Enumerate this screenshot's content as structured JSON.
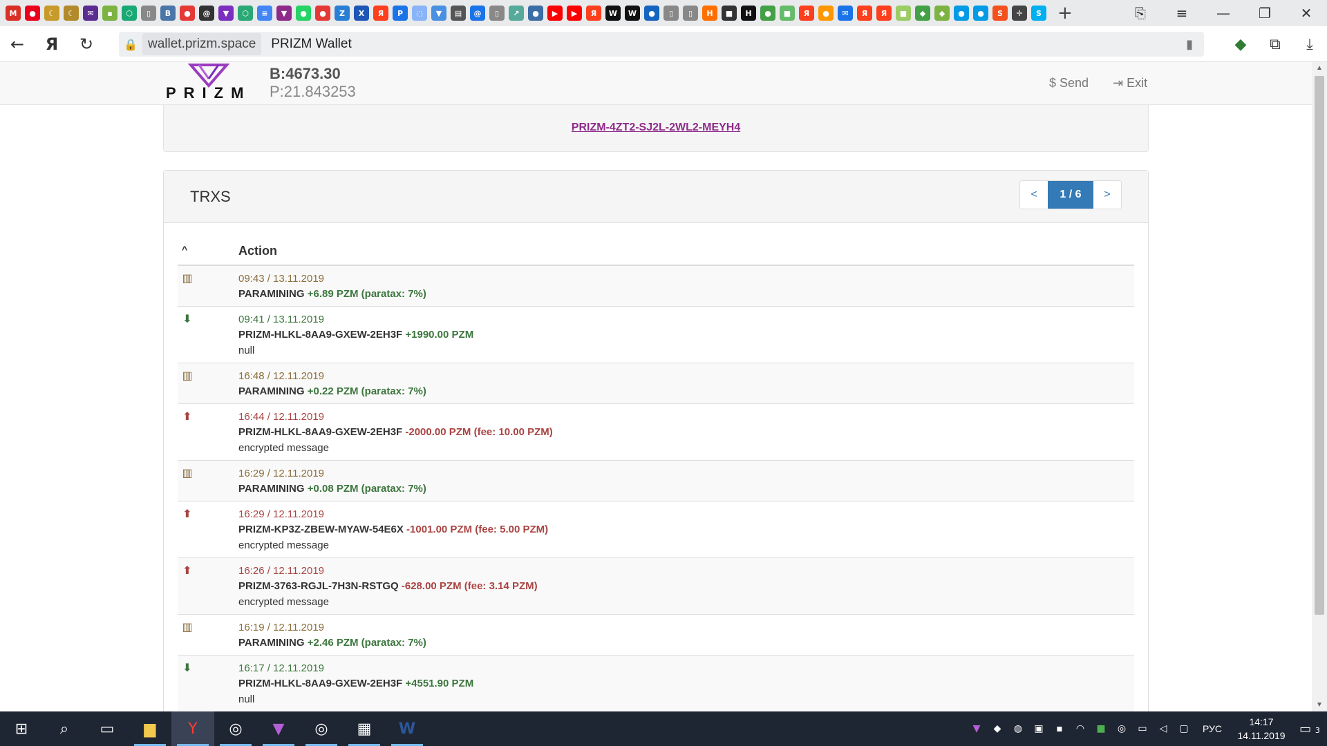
{
  "browser": {
    "favicons": [
      {
        "name": "gmail-icon",
        "glyph": "M",
        "color": "#d93025"
      },
      {
        "name": "mastercard-icon",
        "glyph": "●",
        "color": "#eb001b"
      },
      {
        "name": "moon-icon",
        "glyph": "☾",
        "color": "#c79a2a"
      },
      {
        "name": "moon-alt-icon",
        "glyph": "☾",
        "color": "#b38a2a"
      },
      {
        "name": "mail-icon",
        "glyph": "✉",
        "color": "#5b2d90"
      },
      {
        "name": "green-tab-icon",
        "glyph": "▪",
        "color": "#7cb342"
      },
      {
        "name": "hex-icon",
        "glyph": "⬡",
        "color": "#19a974"
      },
      {
        "name": "doc-icon",
        "glyph": "▯",
        "color": "#888888"
      },
      {
        "name": "vk-icon",
        "glyph": "B",
        "color": "#4a76a8"
      },
      {
        "name": "red-tab-icon",
        "glyph": "●",
        "color": "#e53935"
      },
      {
        "name": "at-icon",
        "glyph": "@",
        "color": "#333333"
      },
      {
        "name": "prism-tab-icon",
        "glyph": "▼",
        "color": "#7b2fbe"
      },
      {
        "name": "hex-green-icon",
        "glyph": "⬡",
        "color": "#2aa876"
      },
      {
        "name": "docs-icon",
        "glyph": "≡",
        "color": "#4285f4"
      },
      {
        "name": "prizm-icon",
        "glyph": "▼",
        "color": "#8e2a8a"
      },
      {
        "name": "whatsapp-icon",
        "glyph": "●",
        "color": "#25d366"
      },
      {
        "name": "red-circle-icon",
        "glyph": "●",
        "color": "#e53935"
      },
      {
        "name": "zw-icon",
        "glyph": "Z",
        "color": "#2a7fd4"
      },
      {
        "name": "ex-icon",
        "glyph": "X",
        "color": "#1e56b5"
      },
      {
        "name": "yandex-icon",
        "glyph": "Я",
        "color": "#fc3f1d"
      },
      {
        "name": "ip-icon",
        "glyph": "P",
        "color": "#1a73e8"
      },
      {
        "name": "bw-icon",
        "glyph": "◌",
        "color": "#8ab4f8"
      },
      {
        "name": "down-tab-icon",
        "glyph": "▼",
        "color": "#4a90e2"
      },
      {
        "name": "news-icon",
        "glyph": "▤",
        "color": "#555555"
      },
      {
        "name": "at-blue-icon",
        "glyph": "@",
        "color": "#1a73e8"
      },
      {
        "name": "file-icon",
        "glyph": "▯",
        "color": "#888888"
      },
      {
        "name": "chart-tab-icon",
        "glyph": "↗",
        "color": "#5a9"
      },
      {
        "name": "globe-icon",
        "glyph": "●",
        "color": "#3a6ea5"
      },
      {
        "name": "youtube-icon",
        "glyph": "▶",
        "color": "#ff0000"
      },
      {
        "name": "youtube-alt-icon",
        "glyph": "▶",
        "color": "#ff0000"
      },
      {
        "name": "yandex-alt-icon",
        "glyph": "Я",
        "color": "#fc3f1d"
      },
      {
        "name": "wix-icon",
        "glyph": "W",
        "color": "#111111"
      },
      {
        "name": "wix-alt-icon",
        "glyph": "W",
        "color": "#111111"
      },
      {
        "name": "soccer-icon",
        "glyph": "●",
        "color": "#1565c0"
      },
      {
        "name": "page-icon",
        "glyph": "▯",
        "color": "#888888"
      },
      {
        "name": "page-alt-icon",
        "glyph": "▯",
        "color": "#888888"
      },
      {
        "name": "hd-icon",
        "glyph": "H",
        "color": "#ff6f00"
      },
      {
        "name": "camera-icon",
        "glyph": "■",
        "color": "#333333"
      },
      {
        "name": "hd-black-icon",
        "glyph": "H",
        "color": "#111111"
      },
      {
        "name": "leaf-icon",
        "glyph": "●",
        "color": "#43a047"
      },
      {
        "name": "green-square-icon",
        "glyph": "■",
        "color": "#66bb6a"
      },
      {
        "name": "yandex-red-icon",
        "glyph": "Я",
        "color": "#fc3f1d"
      },
      {
        "name": "orange-icon",
        "glyph": "●",
        "color": "#ff9800"
      },
      {
        "name": "envelope-blue-icon",
        "glyph": "✉",
        "color": "#1a73e8"
      },
      {
        "name": "yandex-red-alt-icon",
        "glyph": "Я",
        "color": "#fc3f1d"
      },
      {
        "name": "yandex-red-alt2-icon",
        "glyph": "Я",
        "color": "#fc3f1d"
      },
      {
        "name": "lime-icon",
        "glyph": "■",
        "color": "#9ccc65"
      },
      {
        "name": "shield-tab-icon",
        "glyph": "◆",
        "color": "#43a047"
      },
      {
        "name": "shield-green-icon",
        "glyph": "◆",
        "color": "#7cb342"
      },
      {
        "name": "blue-dot-icon",
        "glyph": "●",
        "color": "#039be5"
      },
      {
        "name": "blue-dot-alt-icon",
        "glyph": "●",
        "color": "#039be5"
      },
      {
        "name": "sq-icon",
        "glyph": "S",
        "color": "#f4511e"
      },
      {
        "name": "crosshair-icon",
        "glyph": "✛",
        "color": "#444444"
      },
      {
        "name": "skype-icon",
        "glyph": "S",
        "color": "#00aff0"
      }
    ],
    "new_tab_glyph": "+",
    "url_domain": "wallet.prizm.space",
    "url_title": "PRIZM Wallet"
  },
  "wallet": {
    "logo_text": "PRIZM",
    "balance": "B:4673.30",
    "paramining": "P:21.843253",
    "nav_send": "$ Send",
    "nav_exit": "⇥ Exit",
    "account_address": "PRIZM-4ZT2-SJ2L-2WL2-MEYH4"
  },
  "transactions": {
    "title": "TRXS",
    "pager": {
      "prev": "<",
      "current": "1 / 6",
      "next": ">"
    },
    "header_sort": "^",
    "header_action": "Action",
    "rows": [
      {
        "kind": "bank",
        "time": "09:43 / 13.11.2019",
        "party": "PARAMINING",
        "amount": "+6.89 PZM (paratax: 7%)",
        "sign": "pos",
        "note": ""
      },
      {
        "kind": "in",
        "time": "09:41 / 13.11.2019",
        "party": "PRIZM-HLKL-8AA9-GXEW-2EH3F",
        "amount": "+1990.00 PZM",
        "sign": "pos",
        "note": "null"
      },
      {
        "kind": "bank",
        "time": "16:48 / 12.11.2019",
        "party": "PARAMINING",
        "amount": "+0.22 PZM (paratax: 7%)",
        "sign": "pos",
        "note": ""
      },
      {
        "kind": "out",
        "time": "16:44 / 12.11.2019",
        "party": "PRIZM-HLKL-8AA9-GXEW-2EH3F",
        "amount": "-2000.00 PZM (fee: 10.00 PZM)",
        "sign": "neg",
        "note": "encrypted message"
      },
      {
        "kind": "bank",
        "time": "16:29 / 12.11.2019",
        "party": "PARAMINING",
        "amount": "+0.08 PZM (paratax: 7%)",
        "sign": "pos",
        "note": ""
      },
      {
        "kind": "out",
        "time": "16:29 / 12.11.2019",
        "party": "PRIZM-KP3Z-ZBEW-MYAW-54E6X",
        "amount": "-1001.00 PZM (fee: 5.00 PZM)",
        "sign": "neg",
        "note": "encrypted message"
      },
      {
        "kind": "out",
        "time": "16:26 / 12.11.2019",
        "party": "PRIZM-3763-RGJL-7H3N-RSTGQ",
        "amount": "-628.00 PZM (fee: 3.14 PZM)",
        "sign": "neg",
        "note": "encrypted message"
      },
      {
        "kind": "bank",
        "time": "16:19 / 12.11.2019",
        "party": "PARAMINING",
        "amount": "+2.46 PZM (paratax: 7%)",
        "sign": "pos",
        "note": ""
      },
      {
        "kind": "in",
        "time": "16:17 / 12.11.2019",
        "party": "PRIZM-HLKL-8AA9-GXEW-2EH3F",
        "amount": "+4551.90 PZM",
        "sign": "pos",
        "note": "null"
      }
    ]
  },
  "taskbar": {
    "apps": [
      {
        "name": "start-button",
        "glyph": "⊞"
      },
      {
        "name": "search-button",
        "glyph": "⌕"
      },
      {
        "name": "task-view-button",
        "glyph": "▭"
      },
      {
        "name": "file-explorer-app",
        "glyph": "▆"
      },
      {
        "name": "yandex-browser-app",
        "glyph": "Y"
      },
      {
        "name": "steam-app",
        "glyph": "◎"
      },
      {
        "name": "prizm-app",
        "glyph": "▼"
      },
      {
        "name": "steam-alt-app",
        "glyph": "◎"
      },
      {
        "name": "calculator-app",
        "glyph": "▦"
      },
      {
        "name": "word-app",
        "glyph": "W"
      }
    ],
    "lang": "РУС",
    "time": "14:17",
    "date": "14.11.2019",
    "notifications": "3"
  }
}
